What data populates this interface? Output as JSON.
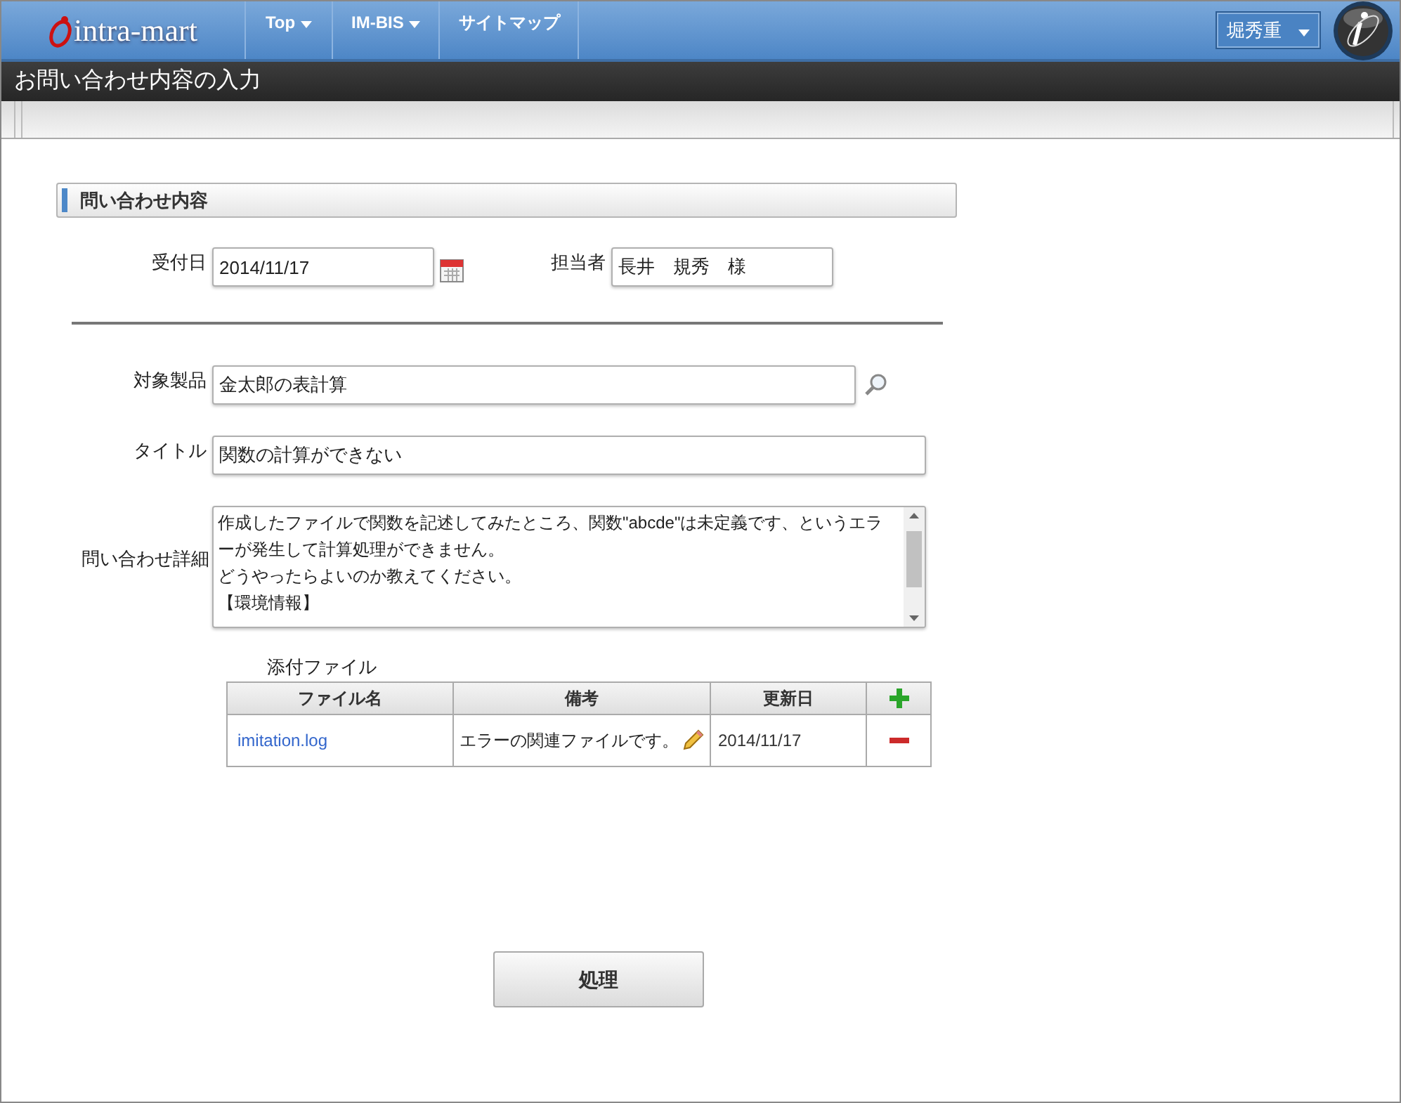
{
  "header": {
    "logo": "intra-mart",
    "nav": [
      {
        "label": "Top",
        "dropdown": true
      },
      {
        "label": "IM-BIS",
        "dropdown": true
      },
      {
        "label": "サイトマップ",
        "dropdown": false
      }
    ],
    "user": "堀秀重"
  },
  "page_title": "お問い合わせ内容の入力",
  "section": {
    "title": "問い合わせ内容"
  },
  "fields": {
    "received_date": {
      "label": "受付日",
      "value": "2014/11/17"
    },
    "assignee": {
      "label": "担当者",
      "value": "長井　規秀　様"
    },
    "product": {
      "label": "対象製品",
      "value": "金太郎の表計算"
    },
    "title": {
      "label": "タイトル",
      "value": "関数の計算ができない"
    },
    "detail": {
      "label": "問い合わせ詳細",
      "lines": [
        "作成したファイルで関数を記述してみたところ、関数\"abcde\"は未定義です、というエラーが発生して計算処理ができません。",
        "どうやったらよいのか教えてください。",
        "【環境情報】"
      ]
    }
  },
  "attachments": {
    "label": "添付ファイル",
    "columns": [
      "ファイル名",
      "備考",
      "更新日"
    ],
    "rows": [
      {
        "file": "imitation.log",
        "note": "エラーの関連ファイルです。",
        "updated": "2014/11/17"
      }
    ]
  },
  "submit": "処理"
}
